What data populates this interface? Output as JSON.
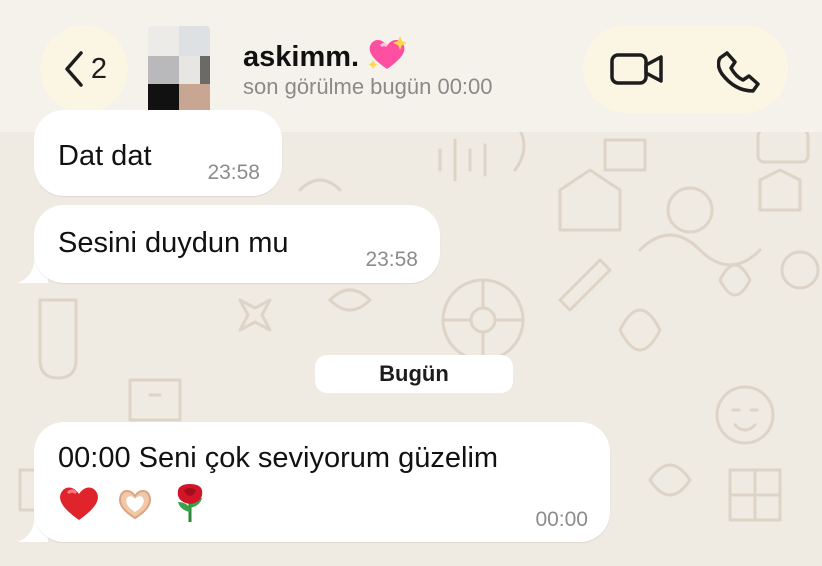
{
  "header": {
    "back_count": "2",
    "contact_name": "askimm.",
    "contact_emoji_icon": "sparkling-heart-icon",
    "status": "son görülme bugün 00:00",
    "video_icon": "video-camera-icon",
    "phone_icon": "phone-icon"
  },
  "messages": [
    {
      "text": "Dat dat",
      "time": "23:58"
    },
    {
      "text": "Sesini duydun mu",
      "time": "23:58"
    }
  ],
  "date_divider": "Bugün",
  "last_message": {
    "text": "00:00 Seni çok seviyorum güzelim",
    "emojis": [
      "red-heart-icon",
      "heart-hands-icon",
      "rose-icon"
    ],
    "time": "00:00"
  },
  "colors": {
    "chat_background": "#efeae2",
    "header_background": "#f5f2ec",
    "pill_background": "#fbf5e4",
    "bubble": "#ffffff",
    "timestamp": "#8c8c8c"
  }
}
